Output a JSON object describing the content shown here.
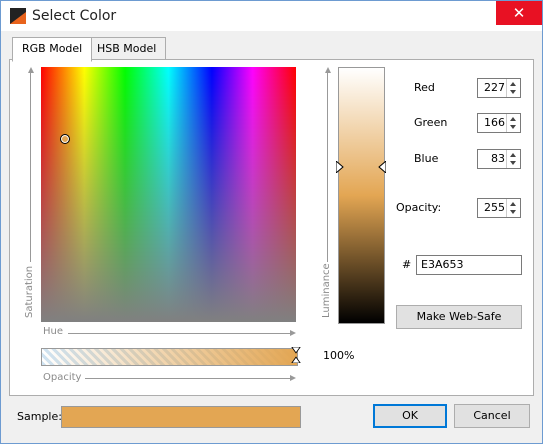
{
  "window": {
    "title": "Select Color",
    "close_glyph": "✕"
  },
  "tabs": [
    {
      "label": "RGB Model",
      "active": true
    },
    {
      "label": "HSB Model",
      "active": false
    }
  ],
  "spectrum": {
    "saturation_label": "Saturation",
    "hue_label": "Hue",
    "opacity_label": "Opacity"
  },
  "luminance": {
    "label": "Luminance"
  },
  "opacity": {
    "percent_text": "100%"
  },
  "fields": {
    "red": {
      "label": "Red",
      "value": "227"
    },
    "green": {
      "label": "Green",
      "value": "166"
    },
    "blue": {
      "label": "Blue",
      "value": "83"
    },
    "opacity": {
      "label": "Opacity:",
      "value": "255"
    },
    "hex": {
      "label": "#",
      "value": "E3A653"
    }
  },
  "buttons": {
    "web_safe": "Make Web-Safe",
    "ok": "OK",
    "cancel": "Cancel"
  },
  "sample": {
    "label": "Sample:"
  },
  "colors": {
    "selected": "#e3a653",
    "accent": "#0078d7",
    "close": "#e81123"
  },
  "icons": {
    "app": "app-icon",
    "close": "close-icon"
  }
}
